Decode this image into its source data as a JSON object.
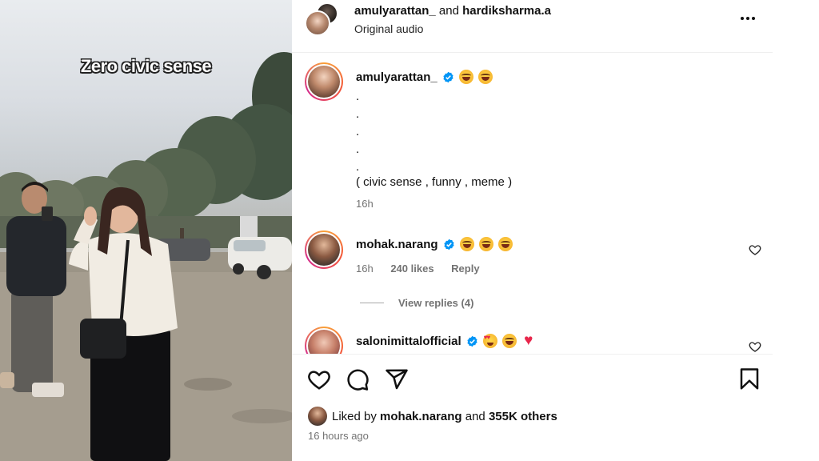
{
  "video": {
    "overlay_text": "Zero civic sense"
  },
  "header": {
    "user1": "amulyarattan_",
    "conjunction": "and",
    "user2": "hardiksharma.a",
    "audio": "Original audio"
  },
  "comments": [
    {
      "username": "amulyarattan_",
      "verified": true,
      "emojis": [
        "laugh",
        "laugh"
      ],
      "dot_lines": [
        ".",
        ".",
        ".",
        ".",
        "."
      ],
      "tags_text": "( civic sense , funny , meme )",
      "time": "16h"
    },
    {
      "username": "mohak.narang",
      "verified": true,
      "emojis": [
        "laugh",
        "laugh",
        "laugh"
      ],
      "time": "16h",
      "likes": "240 likes",
      "reply_label": "Reply",
      "view_replies": "View replies (4)"
    },
    {
      "username": "salonimittalofficial",
      "verified": true,
      "emojis": [
        "heart-eyes",
        "laugh",
        "red-heart"
      ]
    }
  ],
  "actions": {
    "icons": [
      "heart-icon",
      "comment-icon",
      "share-icon",
      "bookmark-icon"
    ]
  },
  "likes": {
    "prefix": "Liked by",
    "user": "mohak.narang",
    "middle": "and",
    "others": "355K others"
  },
  "post_time": "16 hours ago",
  "colors": {
    "verified_blue": "#0095f6",
    "muted_text": "#737373",
    "heart_red": "#e8264b"
  }
}
